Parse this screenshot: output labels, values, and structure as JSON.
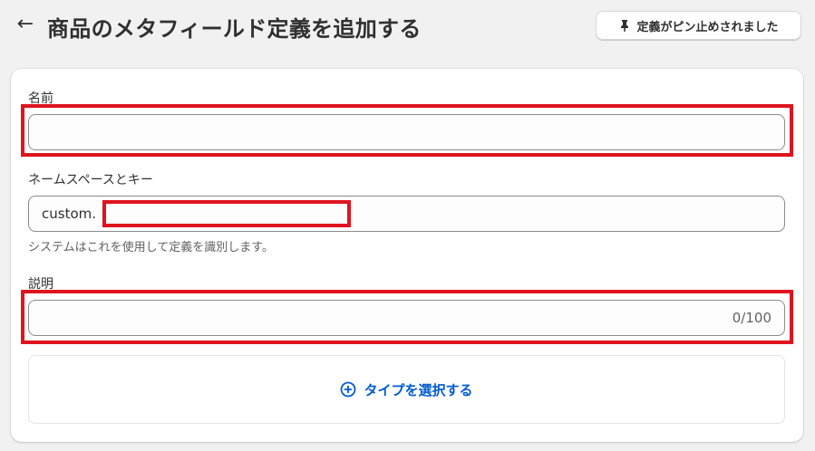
{
  "header": {
    "back_icon": "arrow-left-icon",
    "title": "商品のメタフィールド定義を追加する",
    "pin_button_label": "定義がピン止めされました",
    "pin_icon": "pin-icon"
  },
  "form": {
    "name": {
      "label": "名前",
      "value": ""
    },
    "namespace_key": {
      "label": "ネームスペースとキー",
      "prefix": "custom.",
      "value": "",
      "help": "システムはこれを使用して定義を識別します。"
    },
    "description": {
      "label": "説明",
      "value": "",
      "counter": "0/100"
    },
    "type_selector": {
      "label": "タイプを選択する",
      "icon": "plus-circle-icon"
    }
  },
  "colors": {
    "accent": "#005bd3",
    "highlight": "#e0141e",
    "background": "#f1f1f1",
    "card": "#ffffff"
  }
}
